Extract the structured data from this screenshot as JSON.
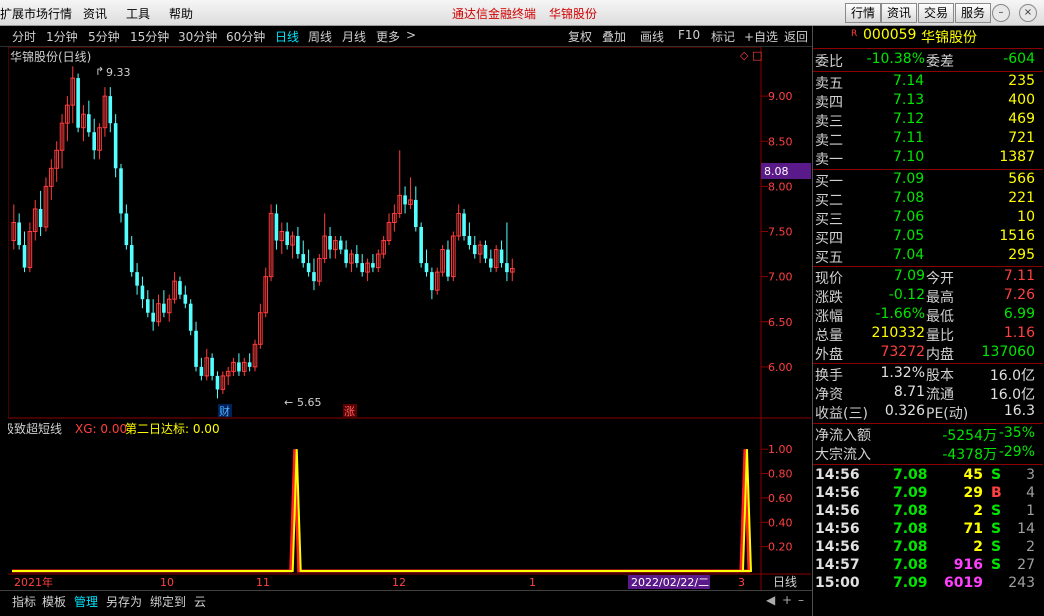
{
  "menu": {
    "items": [
      "扩展市场行情",
      "资讯",
      "工具",
      "帮助"
    ],
    "center_title": "通达信金融终端",
    "center_stock": "华锦股份",
    "right_buttons": [
      "行情",
      "资讯",
      "交易",
      "服务"
    ]
  },
  "periods": {
    "items": [
      "分时",
      "1分钟",
      "5分钟",
      "15分钟",
      "30分钟",
      "60分钟",
      "日线",
      "周线",
      "月线",
      "更多",
      ">"
    ],
    "active": "日线",
    "tools": [
      "复权",
      "叠加",
      "画线",
      "F10",
      "标记",
      "+自选",
      "返回"
    ]
  },
  "chart": {
    "title": "华锦股份(日线)",
    "high_marker": "9.33",
    "low_marker": "5.65",
    "current_price_tag": "8.08",
    "event_tags": [
      "财",
      "涨"
    ],
    "price_axis": [
      "9.00",
      "8.50",
      "8.00",
      "7.50",
      "7.00",
      "6.50",
      "6.00"
    ],
    "indicator_name": "极致超短线",
    "indicator_xg": "XG: 0.00",
    "indicator_second": "第二日达标: 0.00",
    "indicator_axis": [
      "1.00",
      "0.80",
      "0.60",
      "0.40",
      "0.20"
    ],
    "date_axis": [
      "2021年",
      "10",
      "11",
      "12",
      "1",
      "3"
    ],
    "cursor_date": "2022/02/22/二",
    "period_label": "日线"
  },
  "chart_data": {
    "type": "candlestick",
    "title": "华锦股份(日线)",
    "high_label": 9.33,
    "low_label": 5.65,
    "ylim": [
      5.5,
      9.5
    ],
    "candles": [
      {
        "o": 7.4,
        "h": 7.8,
        "l": 7.3,
        "c": 7.6
      },
      {
        "o": 7.6,
        "h": 7.7,
        "l": 7.3,
        "c": 7.35
      },
      {
        "o": 7.35,
        "h": 7.5,
        "l": 7.05,
        "c": 7.1
      },
      {
        "o": 7.1,
        "h": 7.6,
        "l": 7.05,
        "c": 7.5
      },
      {
        "o": 7.5,
        "h": 7.85,
        "l": 7.4,
        "c": 7.75
      },
      {
        "o": 7.75,
        "h": 7.95,
        "l": 7.45,
        "c": 7.55
      },
      {
        "o": 7.55,
        "h": 8.1,
        "l": 7.5,
        "c": 8.0
      },
      {
        "o": 8.0,
        "h": 8.3,
        "l": 7.85,
        "c": 8.2
      },
      {
        "o": 8.2,
        "h": 8.5,
        "l": 8.05,
        "c": 8.4
      },
      {
        "o": 8.4,
        "h": 8.8,
        "l": 8.2,
        "c": 8.7
      },
      {
        "o": 8.7,
        "h": 9.0,
        "l": 8.5,
        "c": 8.9
      },
      {
        "o": 8.9,
        "h": 9.33,
        "l": 8.7,
        "c": 9.2
      },
      {
        "o": 9.2,
        "h": 9.25,
        "l": 8.6,
        "c": 8.65
      },
      {
        "o": 8.65,
        "h": 8.9,
        "l": 8.5,
        "c": 8.8
      },
      {
        "o": 8.8,
        "h": 8.95,
        "l": 8.55,
        "c": 8.6
      },
      {
        "o": 8.6,
        "h": 8.75,
        "l": 8.3,
        "c": 8.4
      },
      {
        "o": 8.4,
        "h": 8.7,
        "l": 8.3,
        "c": 8.65
      },
      {
        "o": 8.65,
        "h": 9.1,
        "l": 8.55,
        "c": 9.0
      },
      {
        "o": 9.0,
        "h": 9.1,
        "l": 8.6,
        "c": 8.7
      },
      {
        "o": 8.7,
        "h": 8.8,
        "l": 8.1,
        "c": 8.2
      },
      {
        "o": 8.2,
        "h": 8.25,
        "l": 7.6,
        "c": 7.7
      },
      {
        "o": 7.7,
        "h": 7.8,
        "l": 7.3,
        "c": 7.35
      },
      {
        "o": 7.35,
        "h": 7.45,
        "l": 7.0,
        "c": 7.05
      },
      {
        "o": 7.05,
        "h": 7.15,
        "l": 6.8,
        "c": 6.9
      },
      {
        "o": 6.9,
        "h": 7.0,
        "l": 6.65,
        "c": 6.75
      },
      {
        "o": 6.75,
        "h": 6.85,
        "l": 6.55,
        "c": 6.6
      },
      {
        "o": 6.6,
        "h": 6.75,
        "l": 6.4,
        "c": 6.5
      },
      {
        "o": 6.5,
        "h": 6.8,
        "l": 6.45,
        "c": 6.7
      },
      {
        "o": 6.7,
        "h": 6.85,
        "l": 6.55,
        "c": 6.6
      },
      {
        "o": 6.6,
        "h": 6.8,
        "l": 6.5,
        "c": 6.75
      },
      {
        "o": 6.75,
        "h": 7.05,
        "l": 6.7,
        "c": 6.95
      },
      {
        "o": 6.95,
        "h": 7.0,
        "l": 6.75,
        "c": 6.8
      },
      {
        "o": 6.8,
        "h": 6.9,
        "l": 6.65,
        "c": 6.7
      },
      {
        "o": 6.7,
        "h": 6.75,
        "l": 6.35,
        "c": 6.4
      },
      {
        "o": 6.4,
        "h": 6.5,
        "l": 5.95,
        "c": 6.0
      },
      {
        "o": 6.0,
        "h": 6.1,
        "l": 5.85,
        "c": 5.9
      },
      {
        "o": 5.9,
        "h": 6.2,
        "l": 5.85,
        "c": 6.1
      },
      {
        "o": 6.1,
        "h": 6.15,
        "l": 5.85,
        "c": 5.9
      },
      {
        "o": 5.9,
        "h": 5.95,
        "l": 5.65,
        "c": 5.75
      },
      {
        "o": 5.75,
        "h": 5.95,
        "l": 5.7,
        "c": 5.9
      },
      {
        "o": 5.9,
        "h": 6.0,
        "l": 5.8,
        "c": 5.95
      },
      {
        "o": 5.95,
        "h": 6.1,
        "l": 5.9,
        "c": 6.05
      },
      {
        "o": 6.05,
        "h": 6.15,
        "l": 5.9,
        "c": 5.95
      },
      {
        "o": 5.95,
        "h": 6.1,
        "l": 5.9,
        "c": 6.05
      },
      {
        "o": 6.05,
        "h": 6.15,
        "l": 5.95,
        "c": 6.0
      },
      {
        "o": 6.0,
        "h": 6.3,
        "l": 5.95,
        "c": 6.25
      },
      {
        "o": 6.25,
        "h": 6.7,
        "l": 6.2,
        "c": 6.6
      },
      {
        "o": 6.6,
        "h": 7.1,
        "l": 6.55,
        "c": 7.0
      },
      {
        "o": 7.0,
        "h": 7.8,
        "l": 6.95,
        "c": 7.7
      },
      {
        "o": 7.7,
        "h": 7.8,
        "l": 7.3,
        "c": 7.4
      },
      {
        "o": 7.4,
        "h": 7.6,
        "l": 7.25,
        "c": 7.5
      },
      {
        "o": 7.5,
        "h": 7.6,
        "l": 7.3,
        "c": 7.35
      },
      {
        "o": 7.35,
        "h": 7.5,
        "l": 7.2,
        "c": 7.45
      },
      {
        "o": 7.45,
        "h": 7.55,
        "l": 7.2,
        "c": 7.25
      },
      {
        "o": 7.25,
        "h": 7.4,
        "l": 7.1,
        "c": 7.15
      },
      {
        "o": 7.15,
        "h": 7.3,
        "l": 7.0,
        "c": 7.05
      },
      {
        "o": 7.05,
        "h": 7.2,
        "l": 6.85,
        "c": 6.95
      },
      {
        "o": 6.95,
        "h": 7.25,
        "l": 6.9,
        "c": 7.2
      },
      {
        "o": 7.2,
        "h": 7.7,
        "l": 7.15,
        "c": 7.45
      },
      {
        "o": 7.45,
        "h": 7.55,
        "l": 7.2,
        "c": 7.3
      },
      {
        "o": 7.3,
        "h": 7.45,
        "l": 7.2,
        "c": 7.4
      },
      {
        "o": 7.4,
        "h": 7.45,
        "l": 7.25,
        "c": 7.3
      },
      {
        "o": 7.3,
        "h": 7.4,
        "l": 7.1,
        "c": 7.15
      },
      {
        "o": 7.15,
        "h": 7.3,
        "l": 7.05,
        "c": 7.25
      },
      {
        "o": 7.25,
        "h": 7.35,
        "l": 7.1,
        "c": 7.15
      },
      {
        "o": 7.15,
        "h": 7.25,
        "l": 7.0,
        "c": 7.05
      },
      {
        "o": 7.05,
        "h": 7.2,
        "l": 6.95,
        "c": 7.15
      },
      {
        "o": 7.15,
        "h": 7.25,
        "l": 7.05,
        "c": 7.1
      },
      {
        "o": 7.1,
        "h": 7.3,
        "l": 7.05,
        "c": 7.25
      },
      {
        "o": 7.25,
        "h": 7.45,
        "l": 7.2,
        "c": 7.4
      },
      {
        "o": 7.4,
        "h": 7.7,
        "l": 7.35,
        "c": 7.6
      },
      {
        "o": 7.6,
        "h": 7.8,
        "l": 7.5,
        "c": 7.7
      },
      {
        "o": 7.7,
        "h": 8.4,
        "l": 7.65,
        "c": 7.9
      },
      {
        "o": 7.9,
        "h": 8.0,
        "l": 7.7,
        "c": 7.8
      },
      {
        "o": 7.8,
        "h": 8.1,
        "l": 7.75,
        "c": 7.85
      },
      {
        "o": 7.85,
        "h": 8.0,
        "l": 7.5,
        "c": 7.55
      },
      {
        "o": 7.55,
        "h": 7.6,
        "l": 7.1,
        "c": 7.15
      },
      {
        "o": 7.15,
        "h": 7.3,
        "l": 7.0,
        "c": 7.05
      },
      {
        "o": 7.05,
        "h": 7.1,
        "l": 6.75,
        "c": 6.85
      },
      {
        "o": 6.85,
        "h": 7.1,
        "l": 6.8,
        "c": 7.05
      },
      {
        "o": 7.05,
        "h": 7.35,
        "l": 7.0,
        "c": 7.3
      },
      {
        "o": 7.3,
        "h": 7.4,
        "l": 6.95,
        "c": 7.0
      },
      {
        "o": 7.0,
        "h": 7.5,
        "l": 6.95,
        "c": 7.45
      },
      {
        "o": 7.45,
        "h": 7.8,
        "l": 7.4,
        "c": 7.7
      },
      {
        "o": 7.7,
        "h": 7.75,
        "l": 7.4,
        "c": 7.45
      },
      {
        "o": 7.45,
        "h": 7.6,
        "l": 7.3,
        "c": 7.35
      },
      {
        "o": 7.35,
        "h": 7.45,
        "l": 7.2,
        "c": 7.25
      },
      {
        "o": 7.25,
        "h": 7.4,
        "l": 7.15,
        "c": 7.35
      },
      {
        "o": 7.35,
        "h": 7.4,
        "l": 7.15,
        "c": 7.2
      },
      {
        "o": 7.2,
        "h": 7.3,
        "l": 7.05,
        "c": 7.1
      },
      {
        "o": 7.1,
        "h": 7.35,
        "l": 7.05,
        "c": 7.3
      },
      {
        "o": 7.3,
        "h": 7.4,
        "l": 7.1,
        "c": 7.15
      },
      {
        "o": 7.15,
        "h": 7.6,
        "l": 6.95,
        "c": 7.05
      },
      {
        "o": 7.05,
        "h": 7.2,
        "l": 6.95,
        "c": 7.09
      }
    ],
    "indicator": {
      "name": "极致超短线",
      "series": [
        {
          "name": "XG",
          "value": 0.0
        },
        {
          "name": "第二日达标",
          "value": 0.0
        }
      ],
      "ylim": [
        0,
        1.1
      ],
      "pulse_candles": [
        52,
        53,
        136,
        137
      ]
    }
  },
  "quote": {
    "badge": "R",
    "code": "000059",
    "name": "华锦股份",
    "weibi_label": "委比",
    "weibi": "-10.38%",
    "weicha_label": "委差",
    "weicha": "-604",
    "sell": [
      {
        "label": "卖五",
        "price": "7.14",
        "vol": "235"
      },
      {
        "label": "卖四",
        "price": "7.13",
        "vol": "400"
      },
      {
        "label": "卖三",
        "price": "7.12",
        "vol": "469"
      },
      {
        "label": "卖二",
        "price": "7.11",
        "vol": "721"
      },
      {
        "label": "卖一",
        "price": "7.10",
        "vol": "1387"
      }
    ],
    "buy": [
      {
        "label": "买一",
        "price": "7.09",
        "vol": "566"
      },
      {
        "label": "买二",
        "price": "7.08",
        "vol": "221"
      },
      {
        "label": "买三",
        "price": "7.06",
        "vol": "10"
      },
      {
        "label": "买四",
        "price": "7.05",
        "vol": "1516"
      },
      {
        "label": "买五",
        "price": "7.04",
        "vol": "295"
      }
    ],
    "stats": [
      {
        "l1": "现价",
        "v1": "7.09",
        "c1": "c-green",
        "l2": "今开",
        "v2": "7.11",
        "c2": "c-red"
      },
      {
        "l1": "涨跌",
        "v1": "-0.12",
        "c1": "c-green",
        "l2": "最高",
        "v2": "7.26",
        "c2": "c-red"
      },
      {
        "l1": "涨幅",
        "v1": "-1.66%",
        "c1": "c-green",
        "l2": "最低",
        "v2": "6.99",
        "c2": "c-green"
      },
      {
        "l1": "总量",
        "v1": "210332",
        "c1": "c-yel",
        "l2": "量比",
        "v2": "1.16",
        "c2": "c-red"
      },
      {
        "l1": "外盘",
        "v1": "73272",
        "c1": "c-red",
        "l2": "内盘",
        "v2": "137060",
        "c2": "c-green"
      }
    ],
    "fund": [
      {
        "l1": "换手",
        "v1": "1.32%",
        "l2": "股本",
        "v2": "16.0亿"
      },
      {
        "l1": "净资",
        "v1": "8.71",
        "l2": "流通",
        "v2": "16.0亿"
      },
      {
        "l1": "收益(三)",
        "v1": "0.326",
        "l2": "PE(动)",
        "v2": "16.3"
      }
    ],
    "flow": [
      {
        "label": "净流入额",
        "value": "-5254万",
        "pct": "-35%"
      },
      {
        "label": "大宗流入",
        "value": "-4378万",
        "pct": "-29%"
      }
    ],
    "ticks": [
      {
        "t": "14:56",
        "p": "7.08",
        "v": "45",
        "vc": "c-yel",
        "s": "S",
        "sc": "c-green",
        "n": "3"
      },
      {
        "t": "14:56",
        "p": "7.09",
        "v": "29",
        "vc": "c-yel",
        "s": "B",
        "sc": "c-red",
        "n": "4"
      },
      {
        "t": "14:56",
        "p": "7.08",
        "v": "2",
        "vc": "c-yel",
        "s": "S",
        "sc": "c-green",
        "n": "1"
      },
      {
        "t": "14:56",
        "p": "7.08",
        "v": "71",
        "vc": "c-yel",
        "s": "S",
        "sc": "c-green",
        "n": "14"
      },
      {
        "t": "14:56",
        "p": "7.08",
        "v": "2",
        "vc": "c-yel",
        "s": "S",
        "sc": "c-green",
        "n": "2"
      },
      {
        "t": "14:57",
        "p": "7.08",
        "v": "916",
        "vc": "c-mag",
        "s": "S",
        "sc": "c-green",
        "n": "27"
      },
      {
        "t": "15:00",
        "p": "7.09",
        "v": "6019",
        "vc": "c-mag",
        "s": "",
        "sc": "c-green",
        "n": "243"
      }
    ]
  },
  "bottom": {
    "tabs": [
      "指标",
      "模板",
      "管理",
      "另存为",
      "绑定到",
      "云"
    ],
    "active": "管理"
  }
}
